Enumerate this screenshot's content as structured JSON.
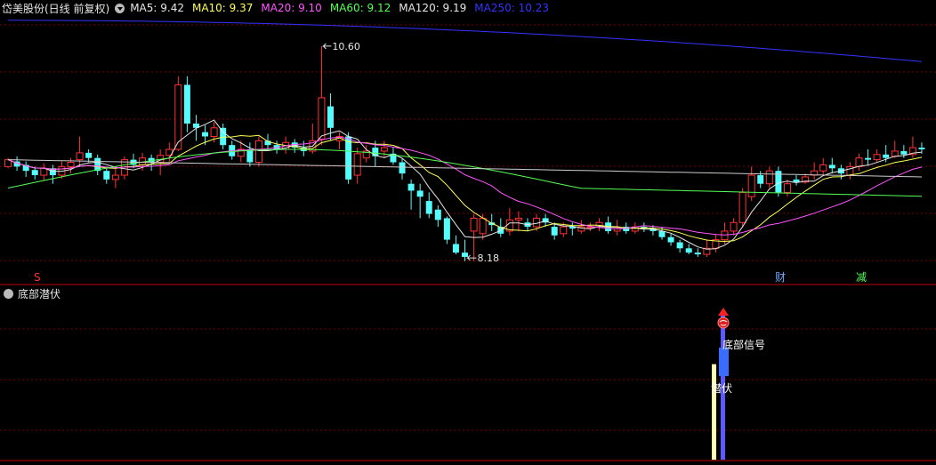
{
  "header": {
    "title": "岱美股份(日线 前复权)",
    "ma": [
      {
        "label": "MA5: 9.42",
        "color": "#e6e6e6"
      },
      {
        "label": "MA10: 9.37",
        "color": "#ffff55"
      },
      {
        "label": "MA20: 9.10",
        "color": "#ff55ff"
      },
      {
        "label": "MA60: 9.12",
        "color": "#55ff55"
      },
      {
        "label": "MA120: 9.19",
        "color": "#e6e6e6"
      },
      {
        "label": "MA250: 10.23",
        "color": "#3333ff"
      }
    ]
  },
  "main_chart": {
    "high_label": "10.60",
    "low_label": "8.18",
    "markers": {
      "s": "S",
      "cai": "财",
      "jian": "减"
    },
    "colors": {
      "up": "#ff3232",
      "down": "#54fcfc",
      "grid": "#7a0000",
      "border": "#c00000"
    }
  },
  "indicator": {
    "title": "底部潜伏",
    "signal_label": "底部信号",
    "latent_label": "潜伏"
  },
  "chart_data": {
    "type": "candlestick",
    "candles": [
      [
        9.2,
        9.28,
        9.3,
        9.18
      ],
      [
        9.26,
        9.2,
        9.32,
        9.15
      ],
      [
        9.22,
        9.15,
        9.26,
        9.08
      ],
      [
        9.16,
        9.1,
        9.2,
        9.05
      ],
      [
        9.1,
        9.18,
        9.24,
        9.04
      ],
      [
        9.18,
        9.1,
        9.22,
        9.0
      ],
      [
        9.1,
        9.2,
        9.26,
        9.06
      ],
      [
        9.2,
        9.25,
        9.3,
        9.12
      ],
      [
        9.28,
        9.36,
        9.55,
        9.2
      ],
      [
        9.36,
        9.3,
        9.4,
        9.25
      ],
      [
        9.3,
        9.15,
        9.34,
        9.1
      ],
      [
        9.15,
        9.05,
        9.2,
        9.0
      ],
      [
        9.05,
        9.1,
        9.18,
        8.95
      ],
      [
        9.1,
        9.28,
        9.32,
        9.05
      ],
      [
        9.28,
        9.22,
        9.35,
        9.18
      ],
      [
        9.22,
        9.3,
        9.36,
        9.15
      ],
      [
        9.3,
        9.25,
        9.34,
        9.15
      ],
      [
        9.25,
        9.33,
        9.4,
        9.1
      ],
      [
        9.33,
        9.4,
        9.48,
        9.25
      ],
      [
        9.4,
        10.15,
        10.25,
        9.38
      ],
      [
        10.15,
        9.7,
        10.25,
        9.6
      ],
      [
        9.7,
        9.65,
        9.8,
        9.5
      ],
      [
        9.6,
        9.55,
        9.68,
        9.45
      ],
      [
        9.55,
        9.65,
        9.72,
        9.48
      ],
      [
        9.65,
        9.45,
        9.7,
        9.4
      ],
      [
        9.45,
        9.32,
        9.5,
        9.28
      ],
      [
        9.32,
        9.4,
        9.5,
        9.25
      ],
      [
        9.4,
        9.25,
        9.48,
        9.2
      ],
      [
        9.25,
        9.5,
        9.55,
        9.2
      ],
      [
        9.5,
        9.45,
        9.58,
        9.38
      ],
      [
        9.45,
        9.4,
        9.5,
        9.35
      ],
      [
        9.4,
        9.48,
        9.55,
        9.35
      ],
      [
        9.48,
        9.42,
        9.52,
        9.36
      ],
      [
        9.42,
        9.38,
        9.5,
        9.32
      ],
      [
        9.38,
        9.5,
        9.7,
        9.35
      ],
      [
        9.52,
        10.0,
        10.6,
        9.45
      ],
      [
        9.9,
        9.65,
        10.05,
        9.5
      ],
      [
        9.5,
        9.55,
        9.6,
        9.4
      ],
      [
        9.55,
        9.05,
        9.6,
        9.0
      ],
      [
        9.1,
        9.35,
        9.42,
        9.0
      ],
      [
        9.3,
        9.38,
        9.45,
        9.25
      ],
      [
        9.42,
        9.32,
        9.5,
        9.2
      ],
      [
        9.38,
        9.42,
        9.5,
        9.3
      ],
      [
        9.35,
        9.25,
        9.42,
        9.22
      ],
      [
        9.25,
        9.12,
        9.3,
        9.05
      ],
      [
        9.0,
        8.92,
        9.05,
        8.7
      ],
      [
        8.92,
        8.85,
        9.0,
        8.6
      ],
      [
        8.8,
        8.65,
        8.9,
        8.6
      ],
      [
        8.7,
        8.58,
        8.75,
        8.5
      ],
      [
        8.6,
        8.35,
        8.62,
        8.3
      ],
      [
        8.3,
        8.2,
        8.4,
        8.18
      ],
      [
        8.2,
        8.15,
        8.35,
        8.1
      ],
      [
        8.45,
        8.6,
        8.65,
        8.1
      ],
      [
        8.42,
        8.6,
        8.65,
        8.35
      ],
      [
        8.55,
        8.52,
        8.65,
        8.45
      ],
      [
        8.5,
        8.42,
        8.6,
        8.38
      ],
      [
        8.45,
        8.58,
        8.72,
        8.4
      ],
      [
        8.58,
        8.6,
        8.68,
        8.45
      ],
      [
        8.55,
        8.5,
        8.6,
        8.45
      ],
      [
        8.5,
        8.6,
        8.65,
        8.45
      ],
      [
        8.6,
        8.55,
        8.65,
        8.5
      ],
      [
        8.5,
        8.4,
        8.55,
        8.35
      ],
      [
        8.42,
        8.5,
        8.55,
        8.38
      ],
      [
        8.5,
        8.48,
        8.55,
        8.4
      ],
      [
        8.45,
        8.5,
        8.58,
        8.42
      ],
      [
        8.5,
        8.5,
        8.55,
        8.45
      ],
      [
        8.5,
        8.55,
        8.6,
        8.45
      ],
      [
        8.55,
        8.45,
        8.62,
        8.42
      ],
      [
        8.45,
        8.48,
        8.58,
        8.4
      ],
      [
        8.5,
        8.45,
        8.55,
        8.42
      ],
      [
        8.45,
        8.5,
        8.55,
        8.42
      ],
      [
        8.5,
        8.48,
        8.55,
        8.44
      ],
      [
        8.48,
        8.45,
        8.52,
        8.4
      ],
      [
        8.45,
        8.38,
        8.5,
        8.35
      ],
      [
        8.38,
        8.32,
        8.42,
        8.28
      ],
      [
        8.32,
        8.25,
        8.35,
        8.2
      ],
      [
        8.25,
        8.2,
        8.3,
        8.18
      ],
      [
        8.2,
        8.18,
        8.25,
        8.15
      ],
      [
        8.18,
        8.25,
        8.35,
        8.15
      ],
      [
        8.25,
        8.35,
        8.42,
        8.2
      ],
      [
        8.35,
        8.45,
        8.55,
        8.3
      ],
      [
        8.45,
        8.55,
        8.6,
        8.4
      ],
      [
        8.55,
        8.9,
        8.95,
        8.5
      ],
      [
        8.85,
        9.1,
        9.2,
        8.8
      ],
      [
        9.1,
        9.0,
        9.15,
        8.95
      ],
      [
        9.0,
        9.15,
        9.2,
        8.95
      ],
      [
        9.15,
        8.9,
        9.2,
        8.85
      ],
      [
        8.9,
        9.0,
        9.05,
        8.85
      ],
      [
        9.05,
        9.02,
        9.1,
        8.98
      ],
      [
        9.02,
        9.08,
        9.12,
        9.0
      ],
      [
        9.1,
        9.15,
        9.25,
        9.05
      ],
      [
        9.15,
        9.22,
        9.3,
        9.1
      ],
      [
        9.22,
        9.18,
        9.3,
        9.12
      ],
      [
        9.18,
        9.12,
        9.22,
        9.05
      ],
      [
        9.1,
        9.2,
        9.25,
        9.05
      ],
      [
        9.2,
        9.3,
        9.35,
        9.15
      ],
      [
        9.3,
        9.28,
        9.4,
        9.22
      ],
      [
        9.28,
        9.34,
        9.4,
        9.25
      ],
      [
        9.34,
        9.3,
        9.45,
        9.25
      ],
      [
        9.32,
        9.38,
        9.5,
        9.3
      ],
      [
        9.38,
        9.34,
        9.45,
        9.3
      ],
      [
        9.34,
        9.42,
        9.55,
        9.3
      ],
      [
        9.42,
        9.4,
        9.48,
        9.35
      ]
    ],
    "ma_final": {
      "MA5": 9.42,
      "MA10": 9.37,
      "MA20": 9.1,
      "MA60": 9.12,
      "MA120": 9.19,
      "MA250": 10.23
    },
    "high": 10.6,
    "low": 8.18,
    "indicator_bars": [
      {
        "name": "latent",
        "color": "#ffffb0",
        "value": 0.6
      },
      {
        "name": "signal",
        "color": "#5a5aff",
        "value": 0.93
      }
    ],
    "grid": true
  }
}
